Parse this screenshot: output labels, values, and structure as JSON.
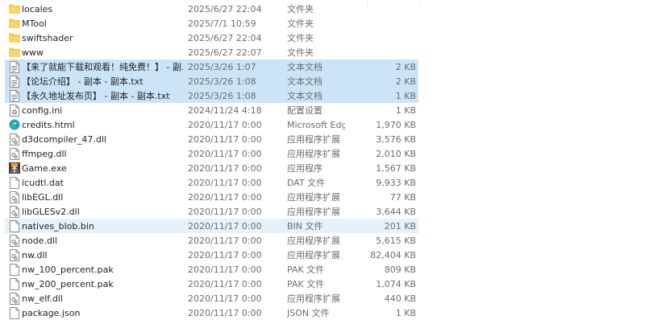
{
  "colors": {
    "selected_bg": "#cce4f7",
    "hover_bg": "#e5f1fb",
    "folder": "#f2c94c",
    "edge": "#1a9fd8"
  },
  "files": [
    {
      "name": "locales",
      "date": "2025/6/27 22:04",
      "type": "文件夹",
      "size": "",
      "icon": "folder-icon",
      "state": ""
    },
    {
      "name": "MTool",
      "date": "2025/7/1 10:59",
      "type": "文件夹",
      "size": "",
      "icon": "folder-icon",
      "state": ""
    },
    {
      "name": "swiftshader",
      "date": "2025/6/27 22:04",
      "type": "文件夹",
      "size": "",
      "icon": "folder-icon",
      "state": ""
    },
    {
      "name": "www",
      "date": "2025/6/27 22:07",
      "type": "文件夹",
      "size": "",
      "icon": "folder-icon",
      "state": ""
    },
    {
      "name": "【来了就能下载和观看！纯免费！】 - 副…",
      "date": "2025/3/26 1:07",
      "type": "文本文档",
      "size": "2 KB",
      "icon": "text-file-icon",
      "state": "selected"
    },
    {
      "name": "【论坛介绍】 - 副本 - 副本.txt",
      "date": "2025/3/26 1:08",
      "type": "文本文档",
      "size": "2 KB",
      "icon": "text-file-icon",
      "state": "selected"
    },
    {
      "name": "【永久地址发布页】 - 副本 - 副本.txt",
      "date": "2025/3/26 1:08",
      "type": "文本文档",
      "size": "1 KB",
      "icon": "text-file-icon",
      "state": "selected"
    },
    {
      "name": "config.ini",
      "date": "2024/11/24 4:18",
      "type": "配置设置",
      "size": "1 KB",
      "icon": "config-file-icon",
      "state": ""
    },
    {
      "name": "credits.html",
      "date": "2020/11/17 0:00",
      "type": "Microsoft Edge ...",
      "size": "1,970 KB",
      "icon": "edge-icon",
      "state": ""
    },
    {
      "name": "d3dcompiler_47.dll",
      "date": "2020/11/17 0:00",
      "type": "应用程序扩展",
      "size": "3,576 KB",
      "icon": "dll-file-icon",
      "state": ""
    },
    {
      "name": "ffmpeg.dll",
      "date": "2020/11/17 0:00",
      "type": "应用程序扩展",
      "size": "2,010 KB",
      "icon": "dll-file-icon",
      "state": ""
    },
    {
      "name": "Game.exe",
      "date": "2020/11/17 0:00",
      "type": "应用程序",
      "size": "1,567 KB",
      "icon": "game-exe-icon",
      "state": ""
    },
    {
      "name": "icudtl.dat",
      "date": "2020/11/17 0:00",
      "type": "DAT 文件",
      "size": "9,933 KB",
      "icon": "blank-file-icon",
      "state": ""
    },
    {
      "name": "libEGL.dll",
      "date": "2020/11/17 0:00",
      "type": "应用程序扩展",
      "size": "77 KB",
      "icon": "dll-file-icon",
      "state": ""
    },
    {
      "name": "libGLESv2.dll",
      "date": "2020/11/17 0:00",
      "type": "应用程序扩展",
      "size": "3,644 KB",
      "icon": "dll-file-icon",
      "state": ""
    },
    {
      "name": "natives_blob.bin",
      "date": "2020/11/17 0:00",
      "type": "BIN 文件",
      "size": "201 KB",
      "icon": "blank-file-icon",
      "state": "hover"
    },
    {
      "name": "node.dll",
      "date": "2020/11/17 0:00",
      "type": "应用程序扩展",
      "size": "5,615 KB",
      "icon": "dll-file-icon",
      "state": ""
    },
    {
      "name": "nw.dll",
      "date": "2020/11/17 0:00",
      "type": "应用程序扩展",
      "size": "82,404 KB",
      "icon": "dll-file-icon",
      "state": ""
    },
    {
      "name": "nw_100_percent.pak",
      "date": "2020/11/17 0:00",
      "type": "PAK 文件",
      "size": "809 KB",
      "icon": "blank-file-icon",
      "state": ""
    },
    {
      "name": "nw_200_percent.pak",
      "date": "2020/11/17 0:00",
      "type": "PAK 文件",
      "size": "1,074 KB",
      "icon": "blank-file-icon",
      "state": ""
    },
    {
      "name": "nw_elf.dll",
      "date": "2020/11/17 0:00",
      "type": "应用程序扩展",
      "size": "440 KB",
      "icon": "dll-file-icon",
      "state": ""
    },
    {
      "name": "package.json",
      "date": "2020/11/17 0:00",
      "type": "JSON 文件",
      "size": "1 KB",
      "icon": "blank-file-icon",
      "state": ""
    }
  ]
}
